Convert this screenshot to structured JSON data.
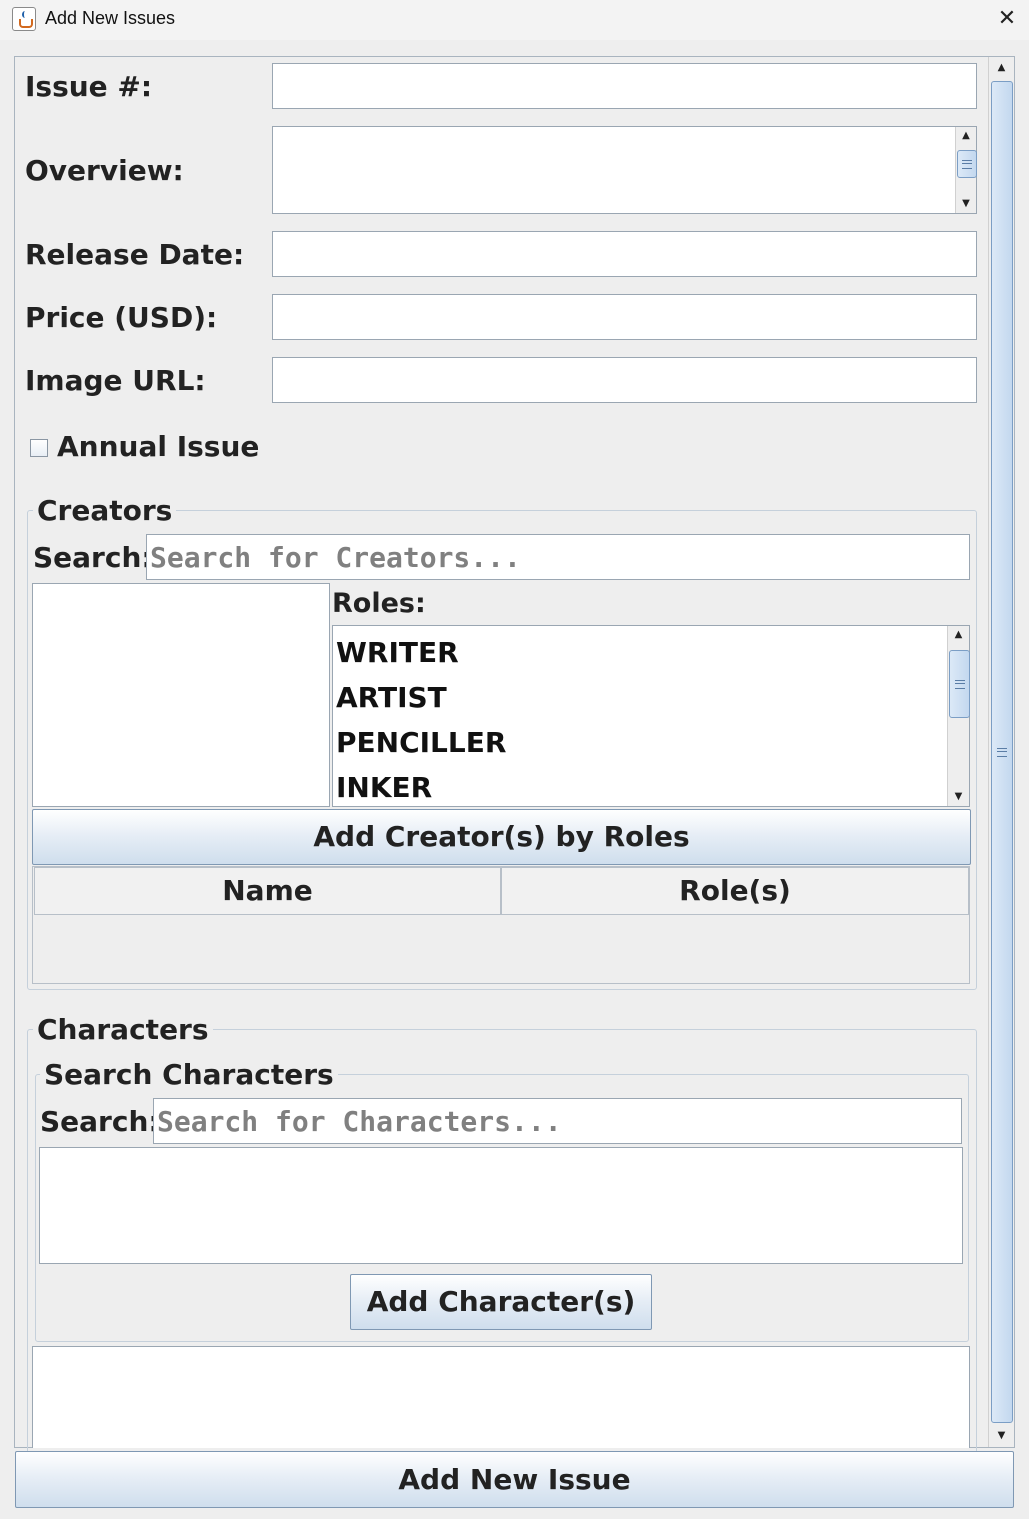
{
  "window": {
    "title": "Add New Issues",
    "close_glyph": "✕"
  },
  "form": {
    "issue_number_label": "Issue #:",
    "issue_number_value": "",
    "overview_label": "Overview:",
    "overview_value": "",
    "release_date_label": "Release Date:",
    "release_date_value": "",
    "price_label": "Price (USD):",
    "price_value": "",
    "image_url_label": "Image URL:",
    "image_url_value": "",
    "annual_issue_label": "Annual Issue",
    "annual_issue_checked": false
  },
  "creators": {
    "title": "Creators",
    "search_label": "Search:",
    "search_placeholder": "Search for Creators...",
    "roles_label": "Roles:",
    "roles": [
      "WRITER",
      "ARTIST",
      "PENCILLER",
      "INKER"
    ],
    "add_button": "Add Creator(s) by Roles",
    "table_headers": [
      "Name",
      "Role(s)"
    ],
    "table_rows": []
  },
  "characters": {
    "title": "Characters",
    "search_group_title": "Search Characters",
    "search_label": "Search:",
    "search_placeholder": "Search for Characters...",
    "add_button": "Add Character(s)"
  },
  "footer": {
    "submit_button": "Add New Issue"
  },
  "colors": {
    "accent_border": "#7b9ec5",
    "button_gradient_bottom": "#cfdeed",
    "background": "#eeeeee"
  }
}
